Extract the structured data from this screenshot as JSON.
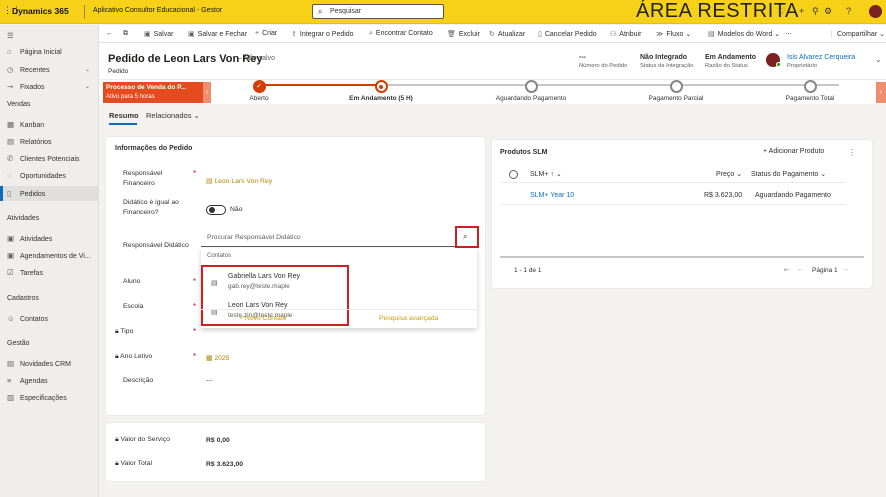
{
  "topbar": {
    "brand": "Dynamics 365",
    "app_name": "Aplicativo Consultor Educacional - Gestor",
    "search_placeholder": "Pesquisar",
    "banner": "ÁREA RESTRITA",
    "icons": [
      "lightbulb-icon",
      "add-icon",
      "filter-icon",
      "settings-icon",
      "help-icon",
      "avatar"
    ]
  },
  "nav": {
    "home": "Página Inicial",
    "recent": "Recentes",
    "pinned": "Fixados",
    "section_sales": "Vendas",
    "kanban": "Kanban",
    "reports": "Relatórios",
    "leads": "Clientes Potenciais",
    "opportunities": "Oportunidades",
    "orders": "Pedidos",
    "section_activities": "Atividades",
    "activities": "Atividades",
    "appointments": "Agendamentos de Vi...",
    "tasks": "Tarefas",
    "section_registry": "Cadastros",
    "contacts": "Contatos",
    "section_management": "Gestão",
    "crm_news": "Novidades CRM",
    "agendas": "Agendas",
    "specs": "Especificações"
  },
  "commands": {
    "save": "Salvar",
    "save_close": "Salvar e Fechar",
    "create": "Criar",
    "integrate": "Integrar o Pedido",
    "find_contact": "Encontrar Contato",
    "delete": "Excluir",
    "refresh": "Atualizar",
    "cancel_order": "Cancelar Pedido",
    "assign": "Atribuir",
    "flow": "Fluxo",
    "word_templates": "Modelos do Word",
    "share": "Compartilhar"
  },
  "header": {
    "title": "Pedido de Leon Lars Von Rey",
    "saved_status": "– Não salvo",
    "entity": "Pedido",
    "order_number_value": "---",
    "order_number_label": "Número do Pedido",
    "integration_value": "Não Integrado",
    "integration_label": "Status da Integração",
    "status_value": "Em Andamento",
    "status_label": "Razão do Status",
    "owner_name": "Isis Alvarez Cerqueira",
    "owner_label": "Proprietário"
  },
  "bpf": {
    "process_name": "Processo de Venda do P...",
    "active_for": "Ativo para 5 horas",
    "stages": [
      "Aberto",
      "Em Andamento  (5 H)",
      "Aguardando Pagamento",
      "Pagamento Parcial",
      "Pagamento Total"
    ]
  },
  "tabs": {
    "summary": "Resumo",
    "related": "Relacionados"
  },
  "form": {
    "section_title": "Informações do Pedido",
    "financial_label": "Responsável Financeiro",
    "financial_value": "Leon Lars Von Rey",
    "same_label": "Didático é igual ao Financeiro?",
    "same_value": "Não",
    "didactic_label": "Responsável Didático",
    "didactic_placeholder": "Procurar Responsável Didático",
    "student_label": "Aluno",
    "school_label": "Escola",
    "type_label": "Tipo",
    "year_label": "Ano Letivo",
    "year_value": "2025",
    "description_label": "Descrição",
    "description_value": "---"
  },
  "lookup_dropdown": {
    "header": "Contatos",
    "results": [
      {
        "name": "Gabriella Lars Von Rey",
        "email": "gab.rey@teste.maple"
      },
      {
        "name": "Leon Lars Von Rey",
        "email": "teste.zin@teste.maple"
      }
    ],
    "new_contact": "Novo Contato",
    "advanced_search": "Pesquisa avançada"
  },
  "totals": {
    "service_label": "Valor do Serviço",
    "service_value": "R$ 0,00",
    "total_label": "Valor Total",
    "total_value": "R$ 3.623,00"
  },
  "products": {
    "title": "Produtos SLM",
    "add_label": "Adicionar Produto",
    "columns": [
      "SLM+ ↑",
      "Preço",
      "Status do Pagamento"
    ],
    "rows": [
      {
        "product": "SLM+ Year 10",
        "price": "R$ 3.623,00",
        "status": "Aguardando Pagamento"
      }
    ],
    "count": "1 - 1 de 1",
    "page": "Página 1"
  },
  "colors": {
    "topbar": "#f7d117",
    "bpf_active": "#d83b01",
    "highlight": "#d11f1f",
    "link": "#0f6cbd"
  }
}
